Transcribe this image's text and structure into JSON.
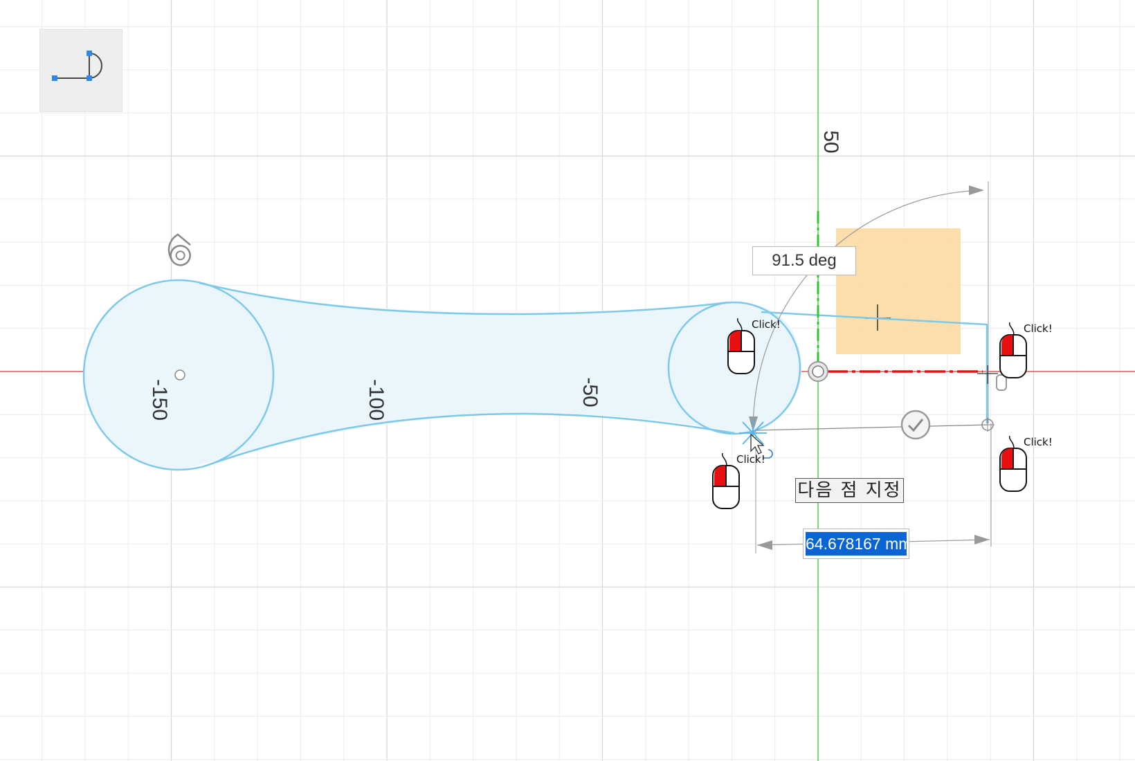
{
  "viewport": {
    "axis_labels": {
      "x_minus_150": "-150",
      "x_minus_100": "-100",
      "x_minus_50": "-50",
      "y_50": "50"
    }
  },
  "sketch": {
    "angle_input": "91.5 deg",
    "length_input": "64.678167 mm",
    "prompt": "다음 점 지정"
  },
  "mouse_hints": [
    {
      "label": "Click!",
      "button": "left"
    },
    {
      "label": "Click!",
      "button": "left"
    },
    {
      "label": "Click!",
      "button": "left"
    },
    {
      "label": "Click!",
      "button": "left"
    }
  ],
  "colors": {
    "profile_stroke": "#7ec8e8",
    "profile_fill": "#eaf5fc",
    "x_axis": "#e85a5a",
    "y_axis": "#4fd24f",
    "highlight": "#fcdca8",
    "selection": "#0a64d4",
    "mouse_button": "#e81010"
  },
  "tool": {
    "icon": "line-arc-icon"
  }
}
